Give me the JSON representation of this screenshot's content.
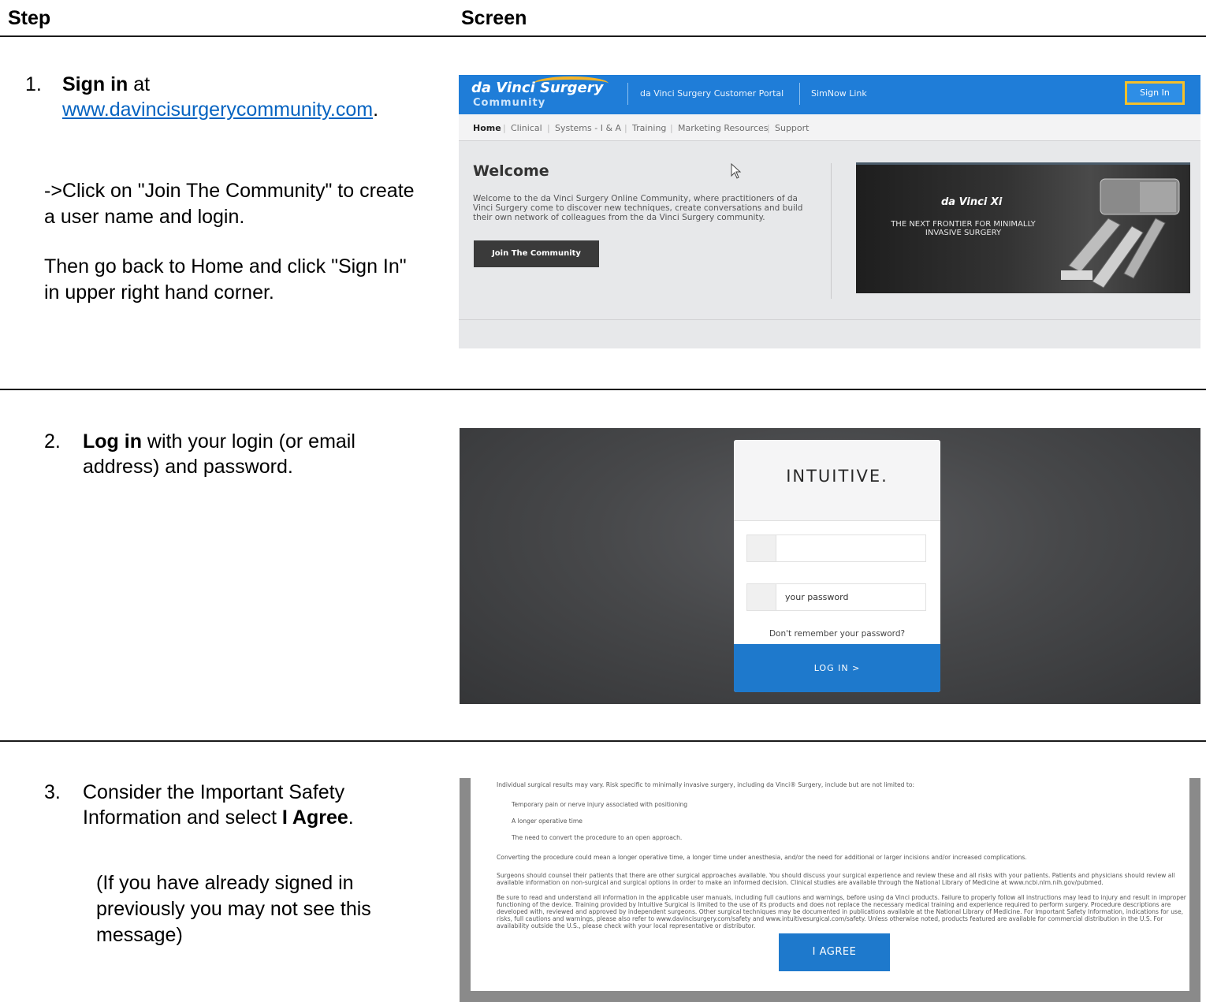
{
  "header": {
    "step": "Step",
    "screen": "Screen"
  },
  "steps": [
    {
      "number": "1.",
      "bold": "Sign in",
      "text_before_link": " at",
      "link": "www.davincisurgerycommunity.com",
      "link_suffix": ".",
      "instruction": "->Click on \"Join The Community\" to create a user name and login.",
      "followup": "Then go back to Home and click \"Sign In\" in upper right hand corner."
    },
    {
      "number": "2.",
      "bold": "Log in",
      "text": " with your login (or email address) and password."
    },
    {
      "number": "3.",
      "text": "Consider the Important Safety Information and select ",
      "bold": "I Agree",
      "suffix": ".",
      "note": "(If you have already signed in previously you may not see this message)"
    }
  ],
  "screen1": {
    "logo": "da Vinci Surgery",
    "logo_sub": "Community",
    "top_links": [
      "da Vinci Surgery Customer Portal",
      "SimNow Link"
    ],
    "sign_in": "Sign In",
    "nav": [
      "Home",
      "Clinical",
      "Systems - I & A",
      "Training",
      "Marketing Resources",
      "Support"
    ],
    "welcome_title": "Welcome",
    "welcome_body": "Welcome to the da Vinci Surgery Online Community, where practitioners of da Vinci Surgery come to discover new techniques, create conversations and build their own network of colleagues from the da Vinci Surgery community.",
    "join_button": "Join The Community",
    "hero_logo": "da Vinci Xi",
    "hero_text": "THE NEXT FRONTIER FOR MINIMALLY INVASIVE SURGERY",
    "colors": {
      "topbar": "#1f7dd8",
      "highlight": "#f5c02a"
    }
  },
  "screen2": {
    "brand": "INTUITIVE.",
    "username_value": "",
    "password_placeholder": "your password",
    "forgot": "Don't remember your password?",
    "login_button": "LOG IN >",
    "colors": {
      "button": "#1e79cc"
    }
  },
  "screen3": {
    "intro": "Individual surgical results may vary. Risk specific to minimally invasive surgery, including da Vinci® Surgery, include but are not limited to:",
    "risks": [
      "Temporary pain or nerve injury associated with positioning",
      "A longer operative time",
      "The need to convert the procedure to an open approach."
    ],
    "converting": "Converting the procedure could mean a longer operative time, a longer time under anesthesia, and/or the need for additional or larger incisions and/or increased complications.",
    "counsel": "Surgeons should counsel their patients that there are other surgical approaches available. You should discuss your surgical experience and review these and all risks with your patients. Patients and physicians should review all available information on non-surgical and surgical options in order to make an informed decision. Clinical studies are available through the National Library of Medicine at www.ncbi.nlm.nih.gov/pubmed.",
    "bessure": "Be sure to read and understand all information in the applicable user manuals, including full cautions and warnings, before using da Vinci products. Failure to properly follow all instructions may lead to injury and result in improper functioning of the device. Training provided by Intuitive Surgical is limited to the use of its products and does not replace the necessary medical training and experience required to perform surgery. Procedure descriptions are developed with, reviewed and approved by independent surgeons. Other surgical techniques may be documented in publications available at the National Library of Medicine. For Important Safety Information, indications for use, risks, full cautions and warnings, please also refer to www.davincisurgery.com/safety and www.intuitivesurgical.com/safety. Unless otherwise noted, products featured are available for commercial distribution in the U.S. For availability outside the U.S., please check with your local representative or distributor.",
    "agree_button": "I AGREE"
  }
}
